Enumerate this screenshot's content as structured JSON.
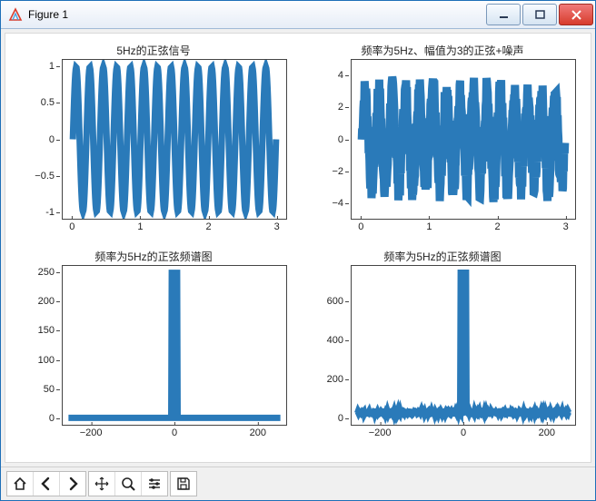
{
  "window": {
    "title": "Figure 1"
  },
  "toolbar": {
    "home": "home-icon",
    "back": "back-icon",
    "forward": "forward-icon",
    "pan": "pan-icon",
    "zoom": "zoom-icon",
    "configure": "sliders-icon",
    "save": "save-icon"
  },
  "chart_data": [
    {
      "id": "tl",
      "type": "line",
      "title": "5Hz的正弦信号",
      "xlim": [
        -0.15,
        3.15
      ],
      "ylim": [
        -1.1,
        1.1
      ],
      "xticks": [
        0,
        1,
        2,
        3
      ],
      "yticks": [
        -1.0,
        -0.5,
        0.0,
        0.5,
        1.0
      ],
      "series": [
        {
          "name": "sin",
          "kind": "sine",
          "freq_hz": 5,
          "amp": 1.0,
          "duration": 3.0,
          "noise": 0
        }
      ]
    },
    {
      "id": "tr",
      "type": "line",
      "title": "频率为5Hz、幅值为3的正弦+噪声",
      "xlim": [
        -0.15,
        3.15
      ],
      "ylim": [
        -5,
        5
      ],
      "xticks": [
        0,
        1,
        2,
        3
      ],
      "yticks": [
        -4,
        -2,
        0,
        2,
        4
      ],
      "series": [
        {
          "name": "sin_noise",
          "kind": "sine",
          "freq_hz": 5,
          "amp": 3.0,
          "duration": 3.0,
          "noise": 1.0
        }
      ]
    },
    {
      "id": "bl",
      "type": "line",
      "title": "频率为5Hz的正弦频谱图",
      "xlim": [
        -270,
        270
      ],
      "ylim": [
        -12,
        262
      ],
      "xticks": [
        -200,
        0,
        200
      ],
      "yticks": [
        0,
        50,
        100,
        150,
        200,
        250
      ],
      "series": [
        {
          "name": "spectrum",
          "kind": "spectrum",
          "peaks": [
            -5,
            5
          ],
          "peak_value": 250,
          "baseline": 0,
          "xrange": [
            -256,
            256
          ]
        }
      ]
    },
    {
      "id": "br",
      "type": "line",
      "title": "频率为5Hz的正弦频谱图",
      "xlim": [
        -270,
        270
      ],
      "ylim": [
        -35,
        785
      ],
      "xticks": [
        -200,
        0,
        200
      ],
      "yticks": [
        0,
        200,
        400,
        600
      ],
      "series": [
        {
          "name": "spectrum_noise",
          "kind": "spectrum",
          "peaks": [
            -5,
            5
          ],
          "peak_value": 750,
          "baseline": 20,
          "noise": 15,
          "xrange": [
            -256,
            256
          ]
        }
      ]
    }
  ]
}
